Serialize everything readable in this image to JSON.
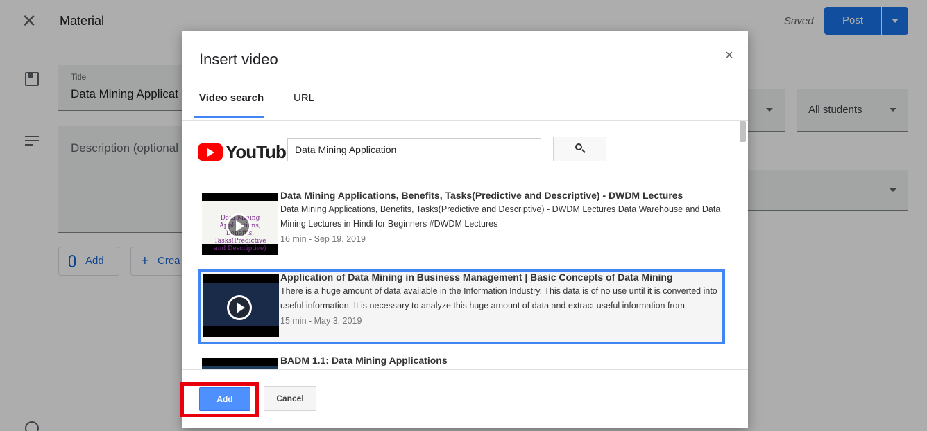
{
  "page": {
    "title": "Material",
    "saved_label": "Saved",
    "post_label": "Post",
    "title_field": {
      "label": "Title",
      "value": "Data Mining Applicat"
    },
    "description_placeholder": "Description (optional",
    "add_label": "Add",
    "create_label": "Crea",
    "right_select_a": "…",
    "right_select_b": "All students"
  },
  "dialog": {
    "title": "Insert video",
    "close_icon": "close-icon",
    "tabs": [
      {
        "label": "Video search",
        "active": true
      },
      {
        "label": "URL",
        "active": false
      }
    ],
    "youtube_logo_text": "YouTube",
    "search": {
      "value": "Data Mining Application",
      "button_icon": "search-icon"
    },
    "results": [
      {
        "title": "Data Mining Applications, Benefits, Tasks(Predictive and Descriptive) - DWDM Lectures",
        "description": "Data Mining Applications, Benefits, Tasks(Predictive and Descriptive) - DWDM Lectures Data Warehouse and Data Mining Lectures in Hindi for Beginners #DWDM Lectures",
        "meta": "16 min - Sep 19, 2019",
        "thumb_text": "Data Mining Applications, Benefits, Tasks(Predictive and Descriptive)",
        "selected": false
      },
      {
        "title": "Application of Data Mining in Business Management | Basic Concepts of Data Mining",
        "description": "There is a huge amount of data available in the Information Industry. This data is of no use until it is converted into useful information. It is necessary to analyze this huge amount of data and extract useful information from",
        "meta": "15 min - May 3, 2019",
        "thumb_text": "",
        "selected": true
      },
      {
        "title": "BADM 1.1: Data Mining Applications",
        "description": "",
        "meta": "",
        "thumb_text": "",
        "selected": false
      }
    ],
    "add_button": "Add",
    "cancel_button": "Cancel"
  },
  "colors": {
    "accent": "#1a73e8",
    "selection_border": "#4285f4",
    "highlight_box": "#e8000d",
    "youtube_red": "#ff0000"
  }
}
